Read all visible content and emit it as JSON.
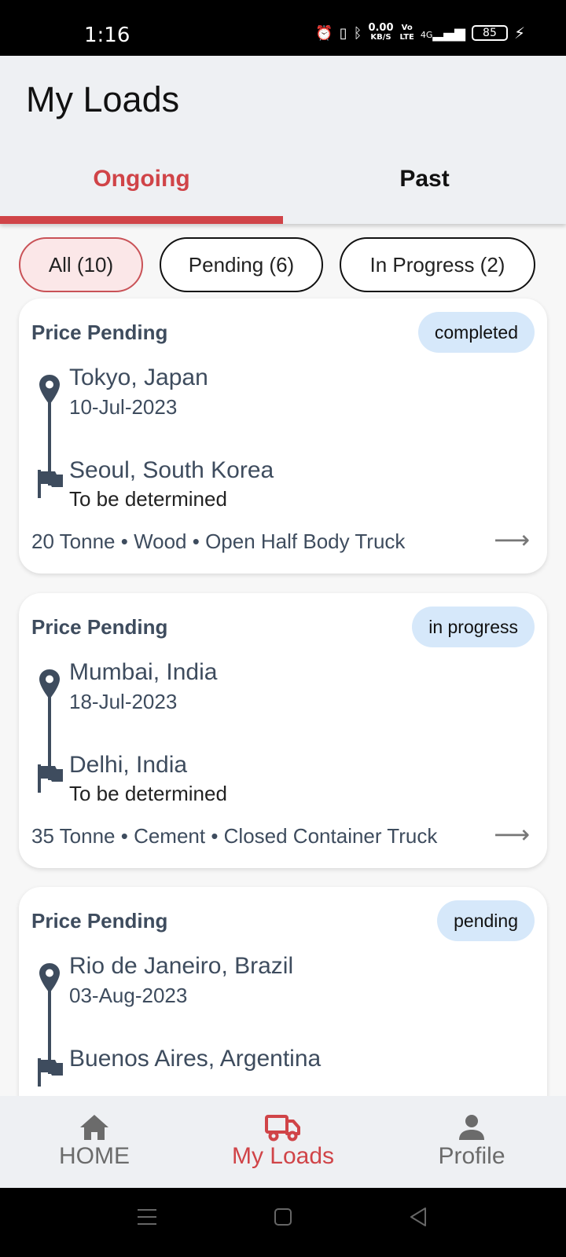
{
  "status_bar": {
    "time": "1:16",
    "net_speed_value": "0.00",
    "net_speed_unit": "KB/S",
    "volte_top": "Vo",
    "volte_bottom": "LTE",
    "network": "4G",
    "battery": "85"
  },
  "header": {
    "title": "My Loads",
    "tabs": [
      {
        "label": "Ongoing",
        "active": true
      },
      {
        "label": "Past",
        "active": false
      }
    ]
  },
  "filters": [
    {
      "label": "All (10)",
      "selected": true
    },
    {
      "label": "Pending (6)",
      "selected": false
    },
    {
      "label": "In Progress (2)",
      "selected": false
    }
  ],
  "loads": [
    {
      "title": "Price Pending",
      "status": "completed",
      "from_city": "Tokyo, Japan",
      "from_date": "10-Jul-2023",
      "to_city": "Seoul, South Korea",
      "to_date": "To be determined",
      "details": "20 Tonne • Wood • Open Half Body Truck"
    },
    {
      "title": "Price Pending",
      "status": "in progress",
      "from_city": "Mumbai, India",
      "from_date": "18-Jul-2023",
      "to_city": "Delhi, India",
      "to_date": "To be determined",
      "details": "35 Tonne • Cement • Closed Container Truck"
    },
    {
      "title": "Price Pending",
      "status": "pending",
      "from_city": "Rio de Janeiro, Brazil",
      "from_date": "03-Aug-2023",
      "to_city": "Buenos Aires, Argentina",
      "to_date": "",
      "details": ""
    }
  ],
  "bottom_nav": [
    {
      "label": "HOME",
      "icon": "home-icon",
      "active": false
    },
    {
      "label": "My Loads",
      "icon": "truck-icon",
      "active": true
    },
    {
      "label": "Profile",
      "icon": "person-icon",
      "active": false
    }
  ],
  "colors": {
    "accent": "#d04448",
    "text_slate": "#3e4c5e",
    "badge_bg": "#d6e8fa",
    "chip_selected_bg": "#fbe7e8"
  }
}
